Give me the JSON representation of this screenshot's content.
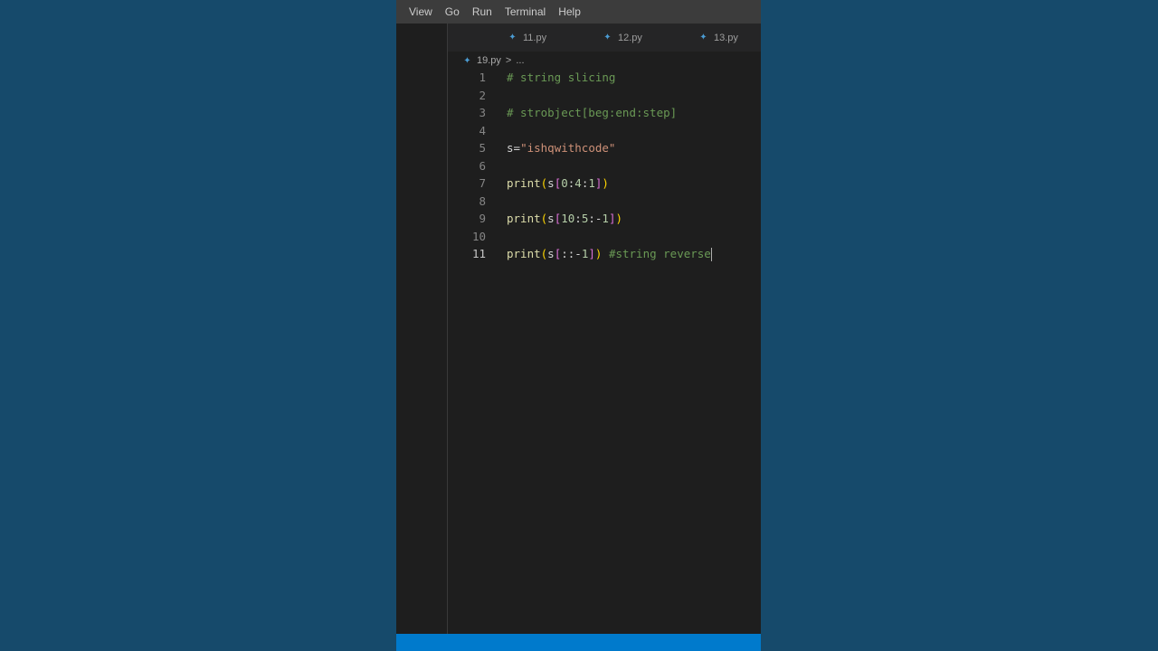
{
  "menu": [
    "View",
    "Go",
    "Run",
    "Terminal",
    "Help"
  ],
  "tabs": [
    {
      "label": "11.py",
      "icon": "python-file-icon"
    },
    {
      "label": "12.py",
      "icon": "python-file-icon"
    },
    {
      "label": "13.py",
      "icon": "python-file-icon"
    }
  ],
  "breadcrumb": {
    "file": "19.py",
    "separator": ">",
    "more": "..."
  },
  "editor": {
    "active_line": 11,
    "lines": [
      {
        "n": "1",
        "tokens": [
          {
            "t": "comment",
            "v": "# string slicing"
          }
        ]
      },
      {
        "n": "2",
        "tokens": []
      },
      {
        "n": "3",
        "tokens": [
          {
            "t": "comment",
            "v": "# strobject[beg:end:step]"
          }
        ]
      },
      {
        "n": "4",
        "tokens": []
      },
      {
        "n": "5",
        "tokens": [
          {
            "t": "plain",
            "v": "s="
          },
          {
            "t": "string",
            "v": "\"ishqwithcode\""
          }
        ]
      },
      {
        "n": "6",
        "tokens": []
      },
      {
        "n": "7",
        "tokens": [
          {
            "t": "func",
            "v": "print"
          },
          {
            "t": "paren",
            "v": "("
          },
          {
            "t": "plain",
            "v": "s"
          },
          {
            "t": "bracket",
            "v": "["
          },
          {
            "t": "num",
            "v": "0"
          },
          {
            "t": "plain",
            "v": ":"
          },
          {
            "t": "num",
            "v": "4"
          },
          {
            "t": "plain",
            "v": ":"
          },
          {
            "t": "num",
            "v": "1"
          },
          {
            "t": "bracket",
            "v": "]"
          },
          {
            "t": "paren",
            "v": ")"
          }
        ]
      },
      {
        "n": "8",
        "tokens": []
      },
      {
        "n": "9",
        "tokens": [
          {
            "t": "func",
            "v": "print"
          },
          {
            "t": "paren",
            "v": "("
          },
          {
            "t": "plain",
            "v": "s"
          },
          {
            "t": "bracket",
            "v": "["
          },
          {
            "t": "num",
            "v": "10"
          },
          {
            "t": "plain",
            "v": ":"
          },
          {
            "t": "num",
            "v": "5"
          },
          {
            "t": "plain",
            "v": ":-"
          },
          {
            "t": "num",
            "v": "1"
          },
          {
            "t": "bracket",
            "v": "]"
          },
          {
            "t": "paren",
            "v": ")"
          }
        ]
      },
      {
        "n": "10",
        "tokens": []
      },
      {
        "n": "11",
        "tokens": [
          {
            "t": "func",
            "v": "print"
          },
          {
            "t": "paren",
            "v": "("
          },
          {
            "t": "plain",
            "v": "s"
          },
          {
            "t": "bracket",
            "v": "["
          },
          {
            "t": "plain",
            "v": "::-"
          },
          {
            "t": "num",
            "v": "1"
          },
          {
            "t": "bracket",
            "v": "]"
          },
          {
            "t": "paren",
            "v": ")"
          },
          {
            "t": "plain",
            "v": " "
          },
          {
            "t": "comment",
            "v": "#string reverse"
          }
        ]
      }
    ]
  },
  "colors": {
    "background": "#164a6b",
    "editor_bg": "#1e1e1e",
    "menubar_bg": "#3c3c3c",
    "statusbar_bg": "#007acc",
    "comment": "#6a9955",
    "string": "#ce9178",
    "function": "#dcdcaa",
    "number": "#b5cea8"
  }
}
